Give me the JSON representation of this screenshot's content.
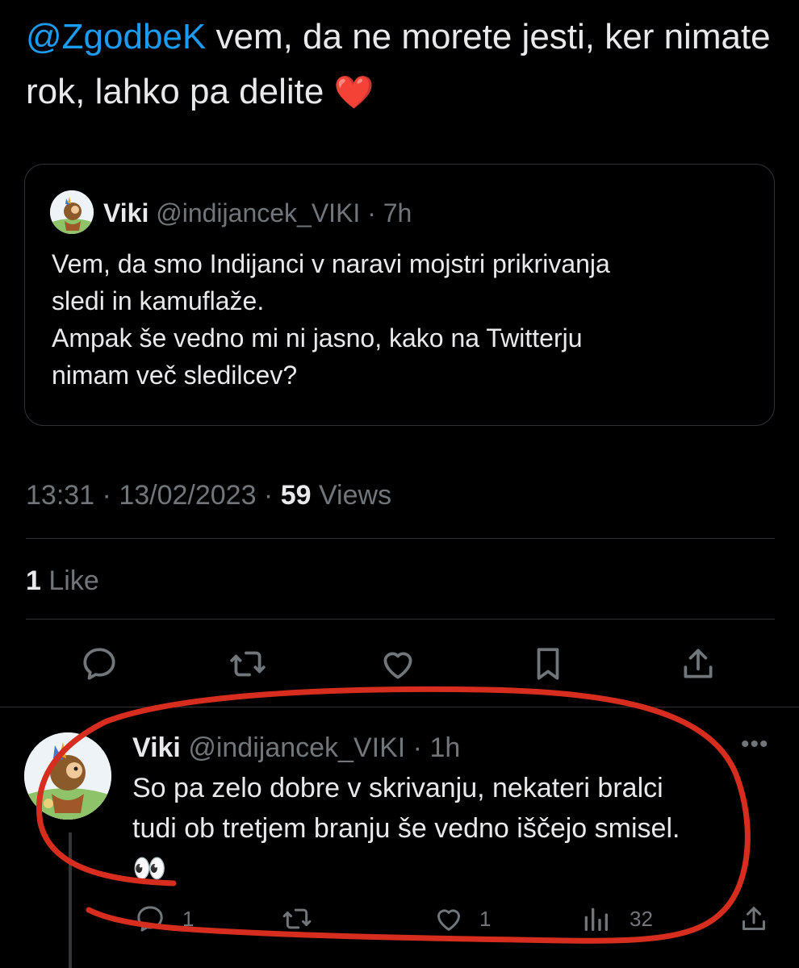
{
  "tweet": {
    "mention": "@ZgodbeK",
    "text": " vem, da ne morete jesti, ker nimate rok, lahko pa delite ",
    "emoji": "❤️"
  },
  "quote": {
    "name": "Viki",
    "handle": "@indijancek_VIKI",
    "time": "7h",
    "lines": [
      "Vem, da smo Indijanci v naravi mojstri prikrivanja",
      "sledi in kamuflaže.",
      "Ampak še vedno mi ni jasno, kako na Twitterju",
      "nimam več sledilcev?"
    ]
  },
  "meta": {
    "time": "13:31",
    "date": "13/02/2023",
    "views_count": "59",
    "views_label": "Views"
  },
  "likes": {
    "count": "1",
    "label": "Like"
  },
  "actions": {
    "icons": [
      "reply-icon",
      "retweet-icon",
      "like-icon",
      "bookmark-icon",
      "share-icon"
    ]
  },
  "reply": {
    "name": "Viki",
    "handle": "@indijancek_VIKI",
    "time": "1h",
    "lines": [
      "So pa zelo dobre v skrivanju, nekateri bralci",
      "tudi ob tretjem branju še vedno iščejo smisel."
    ],
    "emoji": "👀",
    "reply_count": "1",
    "retweet_count": "",
    "like_count": "1",
    "views_count": "32"
  },
  "colors": {
    "accent": "#1d9bf0",
    "muted": "#71767b",
    "annotation": "#d62d1f"
  }
}
